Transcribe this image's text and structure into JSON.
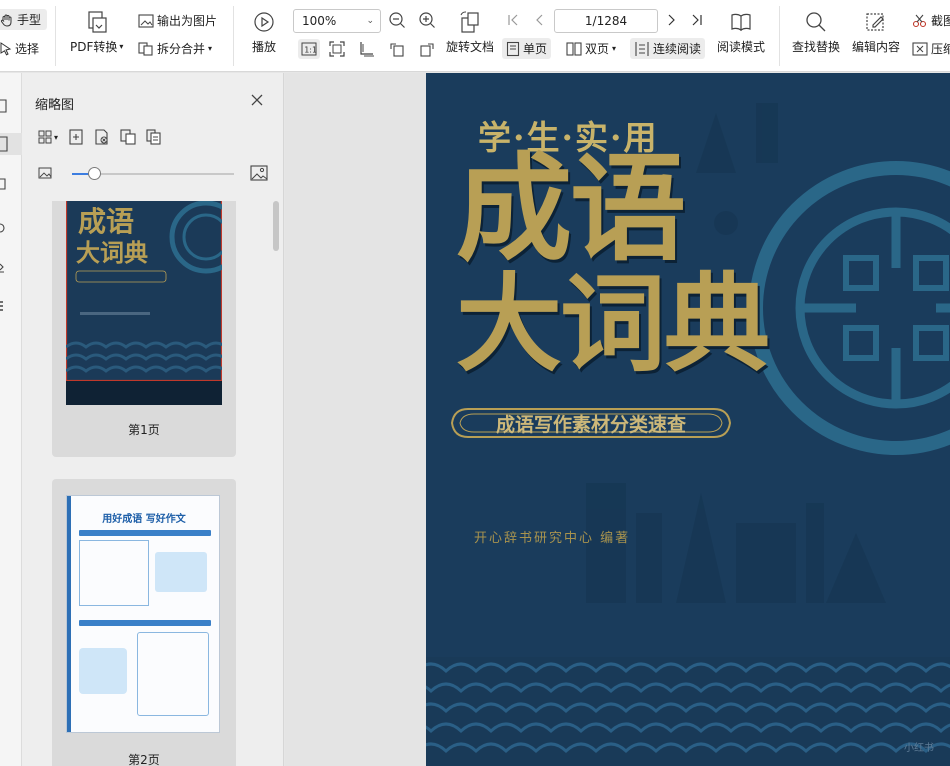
{
  "toolbar": {
    "hand_label": "手型",
    "select_label": "选择",
    "export_image_label": "输出为图片",
    "pdf_convert_label": "PDF转换",
    "split_merge_label": "拆分合并",
    "play_label": "播放",
    "zoom_value": "100%",
    "page_indicator": "1/1284",
    "rotate_doc_label": "旋转文档",
    "single_page_label": "单页",
    "double_page_label": "双页",
    "continuous_label": "连续阅读",
    "reading_mode_label": "阅读模式",
    "find_replace_label": "查找替换",
    "edit_content_label": "编辑内容",
    "screenshot_label": "截图",
    "compress_label": "压缩"
  },
  "thumbnail_panel": {
    "title": "缩略图",
    "pages": [
      {
        "label": "第1页"
      },
      {
        "label": "第2页"
      }
    ]
  },
  "thumb2": {
    "title": "用好成语  写好作文"
  },
  "cover": {
    "subtitle": "学·生·实·用",
    "title_line1": "成语",
    "title_line2": "大词典",
    "banner": "成语写作素材分类速查",
    "author": "开心辞书研究中心  编著"
  },
  "watermark": "小红书",
  "colors": {
    "accent": "#3c7de0",
    "cover_bg": "#1a3c5c",
    "cover_gold": "#b89f55"
  }
}
